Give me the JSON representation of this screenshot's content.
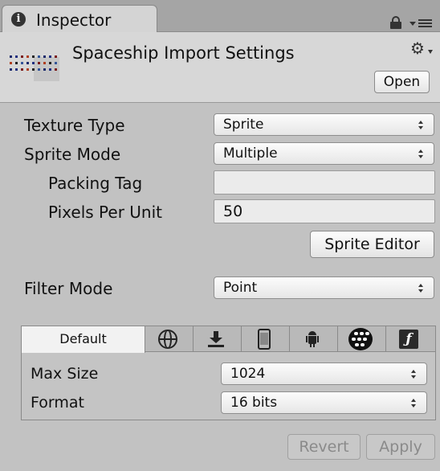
{
  "window": {
    "tab_label": "Inspector",
    "tab_icon_glyph": "i",
    "lock_icon": "lock-icon",
    "menu_icon": "tab-menu-icon"
  },
  "header": {
    "title": "Spaceship Import Settings",
    "gear_glyph": "⚙",
    "open_label": "Open"
  },
  "properties": {
    "texture_type": {
      "label": "Texture Type",
      "value": "Sprite"
    },
    "sprite_mode": {
      "label": "Sprite Mode",
      "value": "Multiple"
    },
    "packing_tag": {
      "label": "Packing Tag",
      "value": ""
    },
    "pixels_per_unit": {
      "label": "Pixels Per Unit",
      "value": "50"
    },
    "sprite_editor_label": "Sprite Editor",
    "filter_mode": {
      "label": "Filter Mode",
      "value": "Point"
    }
  },
  "platforms": {
    "tabs": [
      {
        "label": "Default",
        "icon": "",
        "active": true
      },
      {
        "label": "",
        "icon": "globe-icon"
      },
      {
        "label": "",
        "icon": "download-icon"
      },
      {
        "label": "",
        "icon": "phone-icon"
      },
      {
        "label": "",
        "icon": "android-icon"
      },
      {
        "label": "",
        "icon": "blackberry-icon"
      },
      {
        "label": "",
        "icon": "flash-icon"
      }
    ],
    "max_size": {
      "label": "Max Size",
      "value": "1024"
    },
    "format": {
      "label": "Format",
      "value": "16 bits"
    }
  },
  "footer": {
    "revert_label": "Revert",
    "apply_label": "Apply"
  },
  "colors": {
    "panel_bg": "#c2c2c2",
    "header_bg": "#d7d7d7",
    "tabstrip_bg": "#a5a5a5",
    "disabled_text": "#8a8a8a"
  }
}
